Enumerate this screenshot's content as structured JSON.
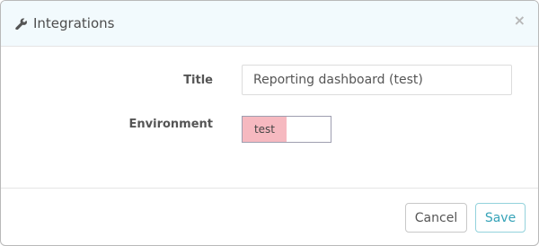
{
  "modal": {
    "title": "Integrations",
    "icon": "wrench-icon",
    "close_label": "×"
  },
  "form": {
    "title_label": "Title",
    "title_value": "Reporting dashboard (test)",
    "environment_label": "Environment",
    "environment_selected": "test",
    "environment_selected_color": "#f6b9c0"
  },
  "footer": {
    "cancel_label": "Cancel",
    "save_label": "Save"
  },
  "colors": {
    "header_background": "#f2fafd",
    "save_accent": "#36a3b8"
  }
}
